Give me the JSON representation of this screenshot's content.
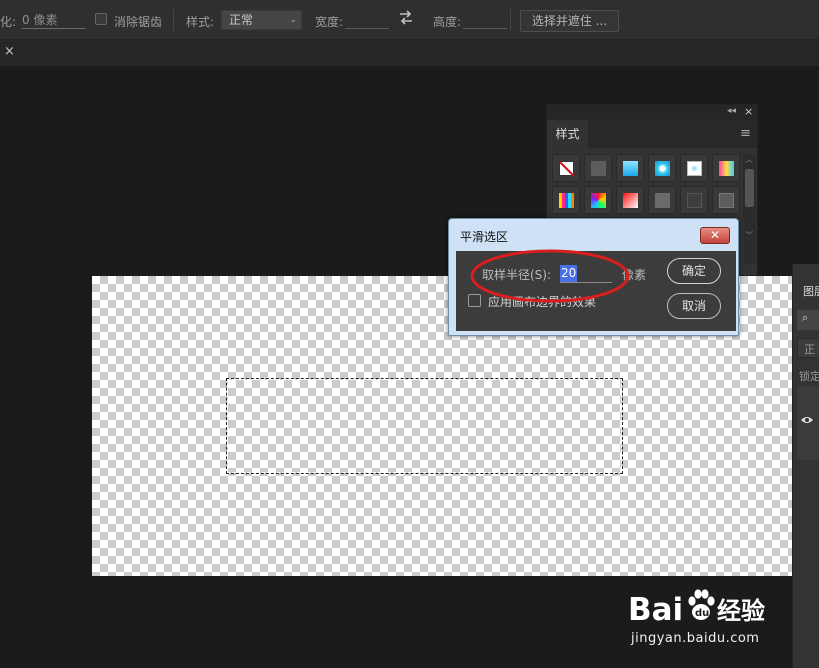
{
  "options_bar": {
    "feather_label": "化:",
    "feather_value": "0 像素",
    "antialias_label": "消除锯齿",
    "style_label": "样式:",
    "style_value": "正常",
    "width_label": "宽度:",
    "height_label": "高度:",
    "select_mask_label": "选择并遮住 ..."
  },
  "tab_strip": {
    "close_glyph": "×"
  },
  "styles_panel": {
    "tab_label": "样式",
    "collapse_glyph": "◂◂",
    "close_glyph": "×",
    "menu_glyph": "≡",
    "swatches": [
      {
        "kind": "none"
      },
      {
        "kind": "gray-dark",
        "color": "#5d5d5d"
      },
      {
        "kind": "cyan-gradient",
        "color": "#2ac8ff"
      },
      {
        "kind": "cyan-dot",
        "color": "#35c8f0"
      },
      {
        "kind": "white-cyan",
        "color": "#e8f8ff"
      },
      {
        "kind": "rainbow",
        "color": "#c040ff"
      },
      {
        "kind": "spectrum-bars",
        "color": "#ff2a80"
      },
      {
        "kind": "rainbow-square",
        "color": "#ffd000"
      },
      {
        "kind": "red-white",
        "color": "#ff2020"
      },
      {
        "kind": "gray-mid",
        "color": "#6a6a6a"
      },
      {
        "kind": "gray-dark2",
        "color": "#484848"
      },
      {
        "kind": "gray-light",
        "color": "#5c5c5c"
      }
    ]
  },
  "layers_panel": {
    "tab_label": "图层",
    "mode_value": "正",
    "lock_label": "锁定"
  },
  "dialog": {
    "title": "平滑选区",
    "close_glyph": "✕",
    "radius_label": "取样半径(S):",
    "radius_value": "20",
    "unit_label": "像素",
    "canvas_bounds_label": "应用画布边界的效果",
    "ok_label": "确定",
    "cancel_label": "取消"
  },
  "watermark": {
    "logo_text": "Bai",
    "logo_text2": "du",
    "logo_cn": "经验",
    "url": "jingyan.baidu.com"
  },
  "colors": {
    "annotation_red": "#d81e1e",
    "dialog_frame": "#cfe2f5",
    "panel_bg": "#323232",
    "app_bg": "#1b1b1b"
  }
}
